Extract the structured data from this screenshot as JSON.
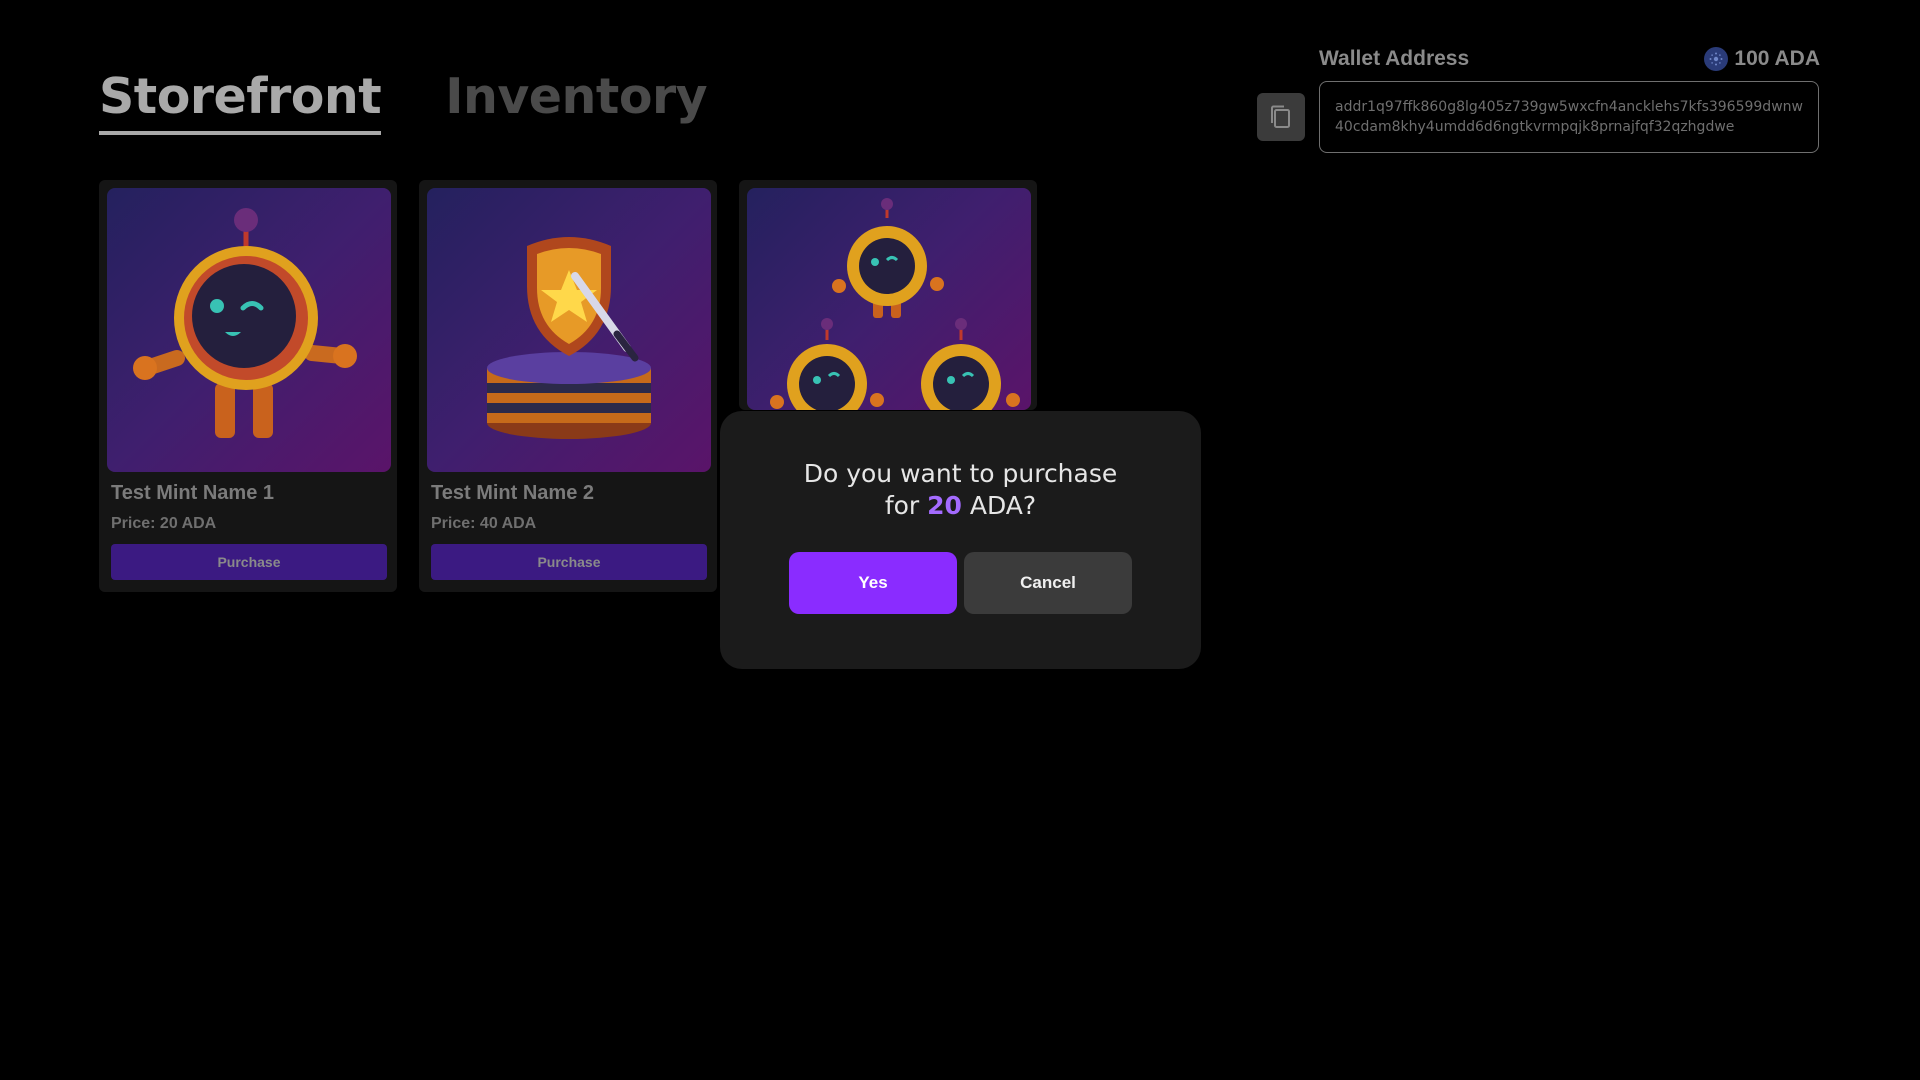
{
  "tabs": [
    {
      "label": "Storefront",
      "active": true
    },
    {
      "label": "Inventory",
      "active": false
    }
  ],
  "wallet": {
    "label": "Wallet Address",
    "balance": "100 ADA",
    "address": "addr1q97ffk860g8lg405z739gw5wxcfn4ancklehs7kfs396599dwnw40cdam8khy4umdd6d6ngtkvrmpqjk8prnajfqf32qzhgdwe",
    "copy_icon": "copy-icon",
    "coin_icon": "ada-coin-icon"
  },
  "cards": [
    {
      "name": "Test Mint Name 1",
      "price": "Price: 20 ADA",
      "button": "Purchase",
      "image": "robot-mascot-illustration"
    },
    {
      "name": "Test Mint Name 2",
      "price": "Price: 40 ADA",
      "button": "Purchase",
      "image": "shield-sword-pedestal-illustration"
    },
    {
      "image": "robot-trio-illustration"
    }
  ],
  "modal": {
    "line1": "Do you want to purchase",
    "line2_prefix": "for ",
    "amount": "20",
    "line2_suffix": " ADA?",
    "yes_label": "Yes",
    "cancel_label": "Cancel"
  },
  "colors": {
    "accent": "#8a2cff",
    "amount": "#a46bff",
    "card_button": "#3b1a82",
    "modal_bg": "#1b1b1b"
  }
}
